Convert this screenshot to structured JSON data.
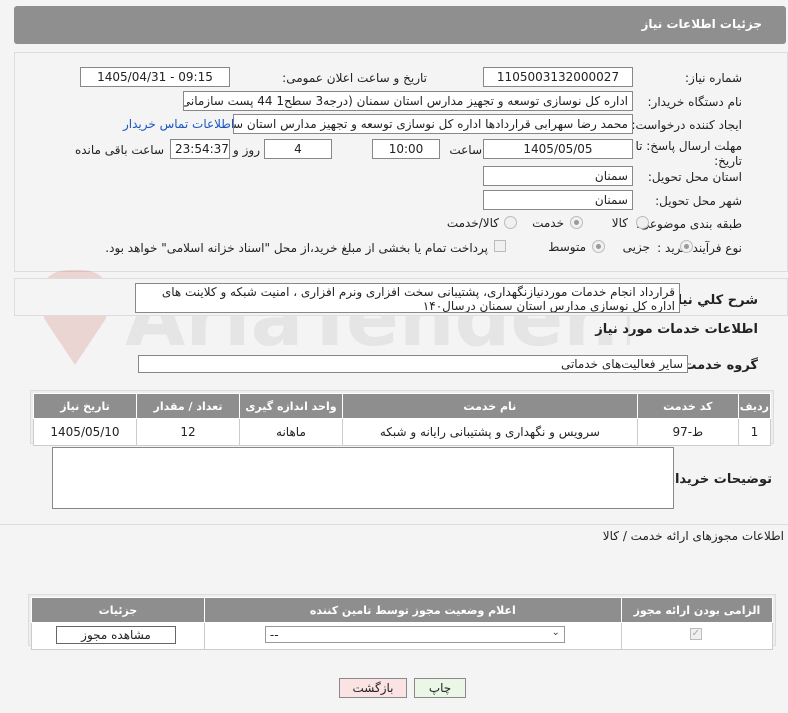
{
  "header": {
    "title": "جزئیات اطلاعات نیاز"
  },
  "form": {
    "need_number_label": "شماره نیاز:",
    "need_number": "1105003132000027",
    "announce_label": "تاریخ و ساعت اعلان عمومی:",
    "announce_value": "1405/04/31 - 09:15",
    "buyer_org_label": "نام دستگاه خریدار:",
    "buyer_org": "اداره کل نوسازی   توسعه و تجهیز مدارس استان سمنان (درجه3  سطح1  44 پست سازمانی)",
    "creator_label": "ایجاد کننده درخواست:",
    "creator": "محمد رضا سهرابی قراردادها اداره کل نوسازی   توسعه و تجهیز مدارس استان سمنان",
    "buyer_contact_link": "اطلاعات تماس خریدار",
    "deadline_label": "مهلت ارسال پاسخ: تا تاریخ:",
    "deadline_date": "1405/05/05",
    "time_label": "ساعت",
    "deadline_time": "10:00",
    "days": "4",
    "days_label": "روز و",
    "remaining_time": "23:54:37",
    "remaining_label": "ساعت باقی مانده",
    "province_label": "استان محل تحویل:",
    "province": "سمنان",
    "city_label": "شهر محل تحویل:",
    "city": "سمنان",
    "category_label": "طبقه بندی موضوعی:",
    "category_options": [
      "کالا",
      "خدمت",
      "کالا/خدمت"
    ],
    "category_selected": "خدمت",
    "process_label": "نوع فرآیند خرید :",
    "process_options": [
      "جزیی",
      "متوسط"
    ],
    "process_selected": "جزیی",
    "payment_note": "پرداخت تمام یا بخشی از مبلغ خرید،از محل \"اسناد خزانه اسلامی\" خواهد بود."
  },
  "summary": {
    "label": "شرح کلي نياز:",
    "text": "قرارداد انجام خدمات موردنیازنگهداری، پشتیبانی سخت افزاری ونرم افزاری ، امنیت شبکه و کلاینت های اداره کل نوسازی مدارس استان سمنان درسال۱۴۰"
  },
  "services": {
    "section_title": "اطلاعات خدمات مورد نیاز",
    "group_label": "گروه خدمت:",
    "group_value": "سایر فعالیت‌های خدماتی",
    "columns": [
      "ردیف",
      "کد خدمت",
      "نام خدمت",
      "واحد اندازه گیری",
      "تعداد / مقدار",
      "تاریخ نیاز"
    ],
    "rows": [
      [
        "1",
        "ط-97",
        "سرویس و نگهداری و پشتیبانی رایانه و شبکه",
        "ماهانه",
        "12",
        "1405/05/10"
      ]
    ]
  },
  "buyer_notes": {
    "label": "توضیحات خریدار:",
    "value": ""
  },
  "permits": {
    "section_title": "اطلاعات مجوزهای ارائه خدمت / کالا",
    "columns": [
      "الزامی بودن ارائه مجوز",
      "اعلام وضعیت مجوز توسط تامین کننده",
      "جزئیات"
    ],
    "select_value": "--",
    "view_button": "مشاهده مجوز"
  },
  "footer": {
    "print_button": "چاپ",
    "back_button": "بازگشت"
  },
  "watermark": "AriaTender.neT"
}
